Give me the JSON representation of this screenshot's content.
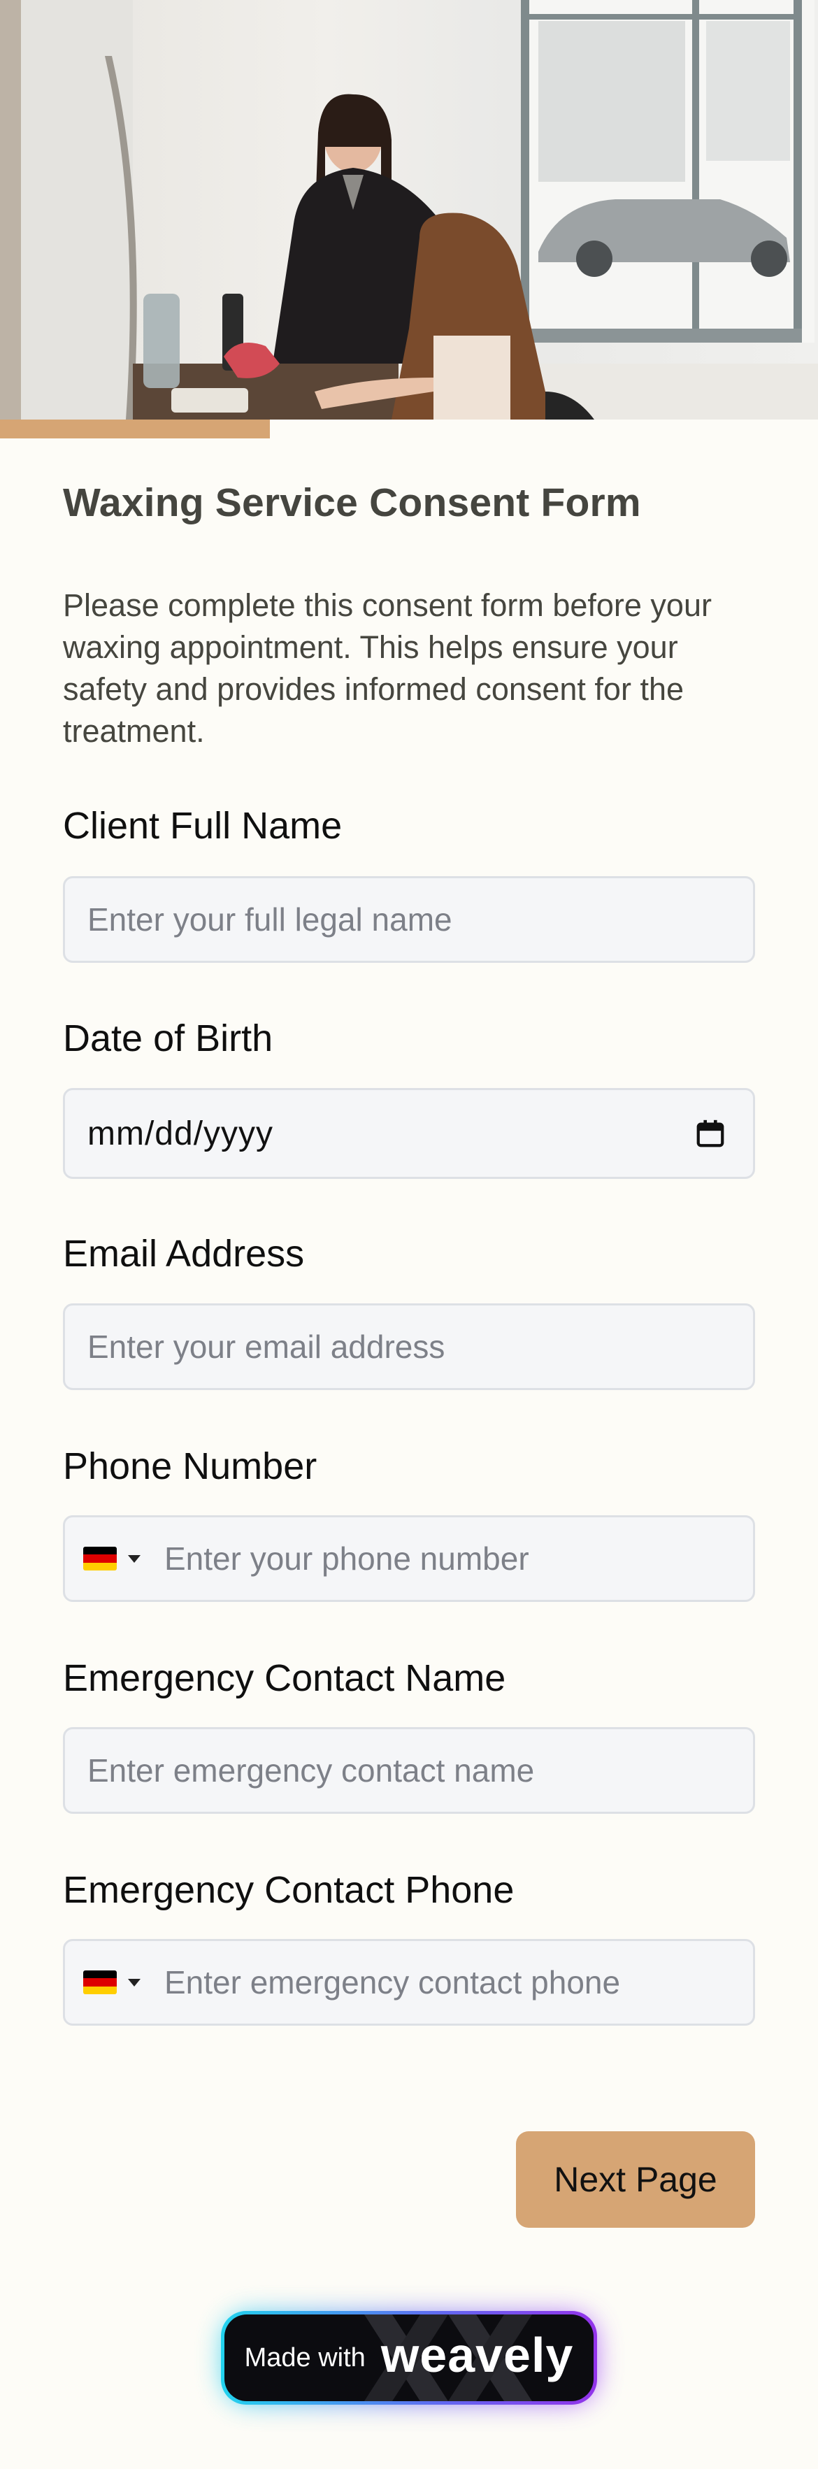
{
  "hero": {
    "image": "salon-waxing-photo"
  },
  "progress": {
    "fraction": 0.33
  },
  "form": {
    "title": "Waxing Service Consent Form",
    "description": "Please complete this consent form before your waxing appointment. This helps ensure your safety and provides informed consent for the treatment."
  },
  "fields": {
    "full_name": {
      "label": "Client Full Name",
      "placeholder": "Enter your full legal name"
    },
    "dob": {
      "label": "Date of Birth",
      "value": "mm/dd/yyyy",
      "icon": "calendar-icon"
    },
    "email": {
      "label": "Email Address",
      "placeholder": "Enter your email address"
    },
    "phone": {
      "label": "Phone Number",
      "placeholder": "Enter your phone number",
      "country_flag": "DE"
    },
    "emergency_name": {
      "label": "Emergency Contact Name",
      "placeholder": "Enter emergency contact name"
    },
    "emergency_phone": {
      "label": "Emergency Contact Phone",
      "placeholder": "Enter emergency contact phone",
      "country_flag": "DE"
    }
  },
  "actions": {
    "next_label": "Next Page"
  },
  "badge": {
    "made_with": "Made with",
    "brand": "weavely"
  },
  "colors": {
    "accent": "#d6a574",
    "background": "#fdfcf7",
    "field_bg": "#f5f6f8"
  }
}
